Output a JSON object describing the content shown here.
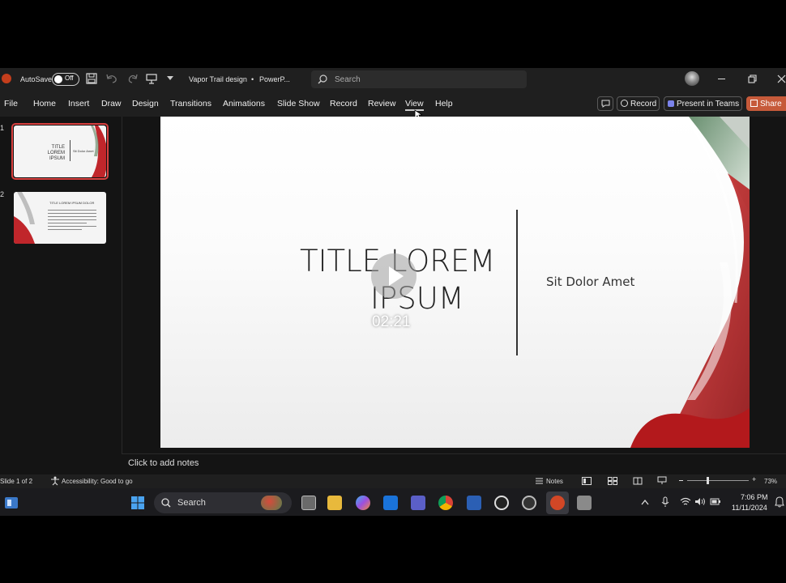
{
  "titlebar": {
    "autosave_label": "AutoSave",
    "autosave_state": "Off",
    "doc_title": "Vapor Trail design",
    "separator": "•",
    "app_name": "PowerP...",
    "search_placeholder": "Search"
  },
  "menu": {
    "items": [
      "File",
      "Home",
      "Insert",
      "Draw",
      "Design",
      "Transitions",
      "Animations",
      "Slide Show",
      "Record",
      "Review",
      "View",
      "Help"
    ],
    "record_button": "Record",
    "present_teams_button": "Present in Teams",
    "share_button": "Share"
  },
  "thumbnails": [
    {
      "number": "1",
      "title": "TITLE LOREM IPSUM",
      "subtitle": "Sit Dolor Amet"
    },
    {
      "number": "2",
      "title": "TITLE LOREM IPSUM DOLOR"
    }
  ],
  "slide": {
    "title_line1": "TITLE LOREM",
    "title_line2": "IPSUM",
    "subtitle": "Sit Dolor Amet"
  },
  "video": {
    "timestamp": "02:21"
  },
  "notes": {
    "placeholder": "Click to add notes"
  },
  "statusbar": {
    "slide_indicator": "Slide 1 of 2",
    "accessibility": "Accessibility: Good to go",
    "notes_button": "Notes",
    "zoom_level": "73%"
  },
  "taskbar": {
    "search_label": "Search",
    "time": "7:06 PM",
    "date": "11/11/2024"
  },
  "colors": {
    "accent_red": "#c0262b",
    "share_orange": "#c65a3a",
    "selected_thumb_border": "#d9403f"
  }
}
